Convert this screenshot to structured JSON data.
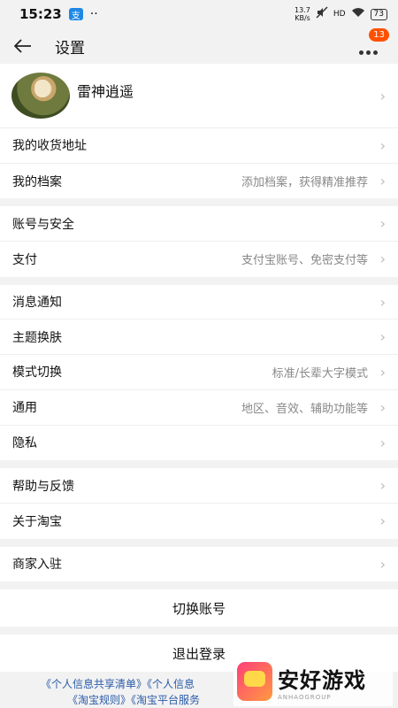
{
  "status_bar": {
    "time": "15:23",
    "app_badge": "支",
    "dots": "··",
    "net_speed_value": "13.7",
    "net_speed_unit": "KB/s",
    "network": "HD",
    "battery": "73"
  },
  "header": {
    "title": "设置",
    "notification_count": "13"
  },
  "profile": {
    "name": "雷神逍遥"
  },
  "groups": [
    {
      "items": [
        {
          "label": "我的收货地址",
          "hint": ""
        },
        {
          "label": "我的档案",
          "hint": "添加档案，获得精准推荐"
        }
      ]
    },
    {
      "items": [
        {
          "label": "账号与安全",
          "hint": ""
        },
        {
          "label": "支付",
          "hint": "支付宝账号、免密支付等"
        }
      ]
    },
    {
      "items": [
        {
          "label": "消息通知",
          "hint": ""
        },
        {
          "label": "主题换肤",
          "hint": ""
        },
        {
          "label": "模式切换",
          "hint": "标准/长辈大字模式"
        },
        {
          "label": "通用",
          "hint": "地区、音效、辅助功能等"
        },
        {
          "label": "隐私",
          "hint": ""
        }
      ]
    },
    {
      "items": [
        {
          "label": "帮助与反馈",
          "hint": ""
        },
        {
          "label": "关于淘宝",
          "hint": ""
        }
      ]
    },
    {
      "items": [
        {
          "label": "商家入驻",
          "hint": ""
        }
      ]
    }
  ],
  "buttons": {
    "switch_account": "切换账号",
    "logout": "退出登录"
  },
  "footer": {
    "line1": "《个人信息共享清单》《个人信息",
    "line2": "《淘宝规则》《淘宝平台服务"
  },
  "watermark": {
    "name": "安好游戏",
    "sub": "ANHAOGROUP"
  }
}
